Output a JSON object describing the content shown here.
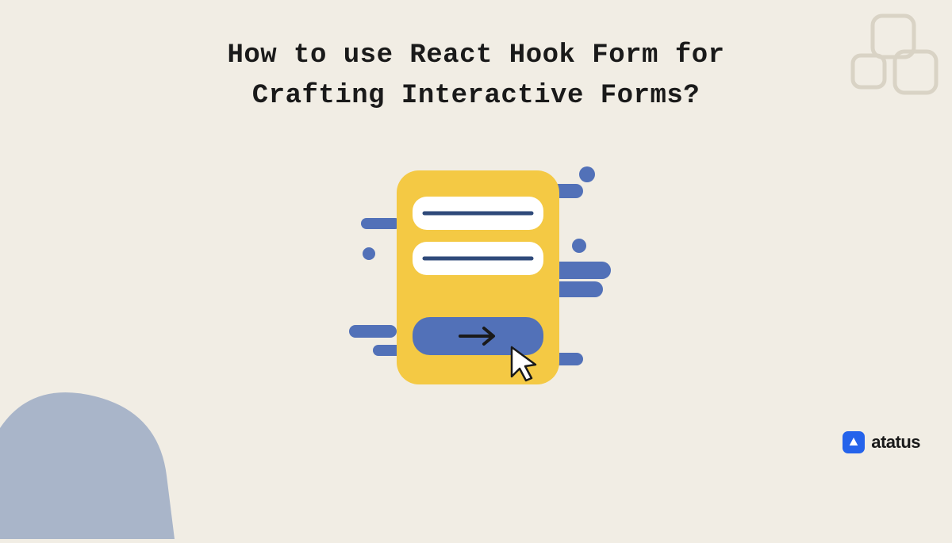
{
  "title": {
    "line1": "How to use React Hook Form for",
    "line2": "Crafting Interactive Forms?"
  },
  "brand": {
    "name": "atatus"
  },
  "colors": {
    "background": "#f1ede4",
    "formCard": "#f4c944",
    "accent": "#5271b8",
    "accentDark": "#2f4a7a",
    "blob": "#a9b5c9",
    "squares": "#d9d3c5",
    "brandBlue": "#2563eb"
  }
}
